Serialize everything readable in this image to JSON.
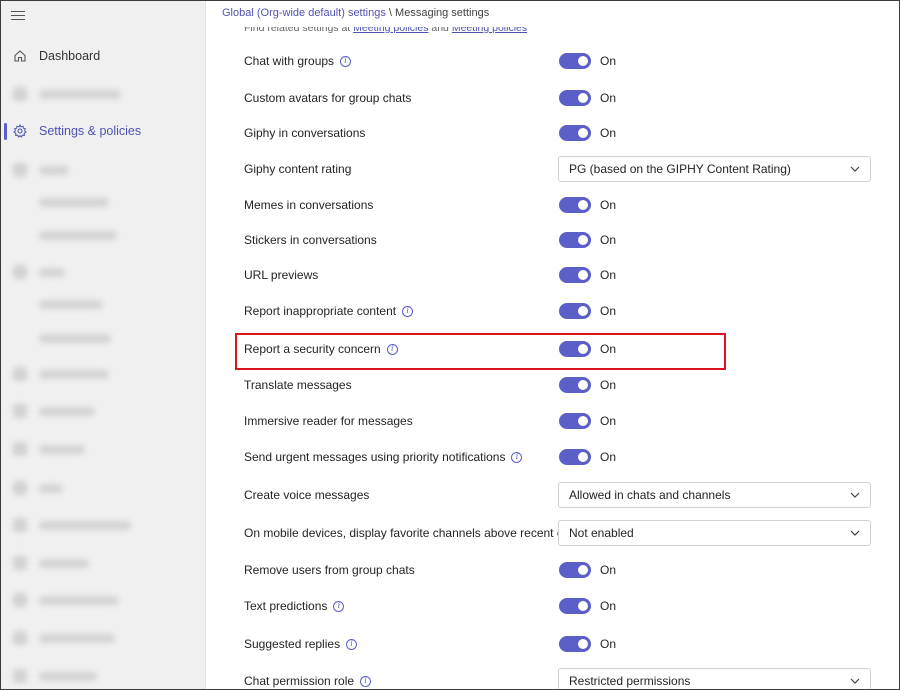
{
  "sidebar": {
    "items": [
      {
        "label": "Dashboard",
        "icon": "home-icon",
        "active": false
      },
      {
        "label": "Settings & policies",
        "icon": "gear-icon",
        "active": true
      }
    ]
  },
  "breadcrumb": {
    "parent": "Global (Org-wide default) settings",
    "separator": "\\",
    "current": "Messaging settings"
  },
  "hint": {
    "prefix": "Find related settings at",
    "link1": "Meeting policies",
    "and": "and",
    "link2": "Meeting policies"
  },
  "settings": [
    {
      "label": "Chat with groups",
      "info": true,
      "type": "toggle",
      "value": "On"
    },
    {
      "label": "Custom avatars for group chats",
      "info": false,
      "type": "toggle",
      "value": "On"
    },
    {
      "label": "Giphy in conversations",
      "info": false,
      "type": "toggle",
      "value": "On"
    },
    {
      "label": "Giphy content rating",
      "info": false,
      "type": "select",
      "value": "PG (based on the GIPHY Content Rating)"
    },
    {
      "label": "Memes in conversations",
      "info": false,
      "type": "toggle",
      "value": "On"
    },
    {
      "label": "Stickers in conversations",
      "info": false,
      "type": "toggle",
      "value": "On"
    },
    {
      "label": "URL previews",
      "info": false,
      "type": "toggle",
      "value": "On"
    },
    {
      "label": "Report inappropriate content",
      "info": true,
      "type": "toggle",
      "value": "On"
    },
    {
      "label": "Report a security concern",
      "info": true,
      "type": "toggle",
      "value": "On"
    },
    {
      "label": "Translate messages",
      "info": false,
      "type": "toggle",
      "value": "On"
    },
    {
      "label": "Immersive reader for messages",
      "info": false,
      "type": "toggle",
      "value": "On"
    },
    {
      "label": "Send urgent messages using priority notifications",
      "info": true,
      "type": "toggle",
      "value": "On"
    },
    {
      "label": "Create voice messages",
      "info": false,
      "type": "select",
      "value": "Allowed in chats and channels"
    },
    {
      "label": "On mobile devices, display favorite channels above recent chats",
      "info": false,
      "type": "select",
      "value": "Not enabled"
    },
    {
      "label": "Remove users from group chats",
      "info": false,
      "type": "toggle",
      "value": "On"
    },
    {
      "label": "Text predictions",
      "info": true,
      "type": "toggle",
      "value": "On"
    },
    {
      "label": "Suggested replies",
      "info": true,
      "type": "toggle",
      "value": "On"
    },
    {
      "label": "Chat permission role",
      "info": true,
      "type": "select",
      "value": "Restricted permissions"
    }
  ],
  "colors": {
    "accent": "#5b5fc7",
    "highlight": "#d9141e"
  }
}
